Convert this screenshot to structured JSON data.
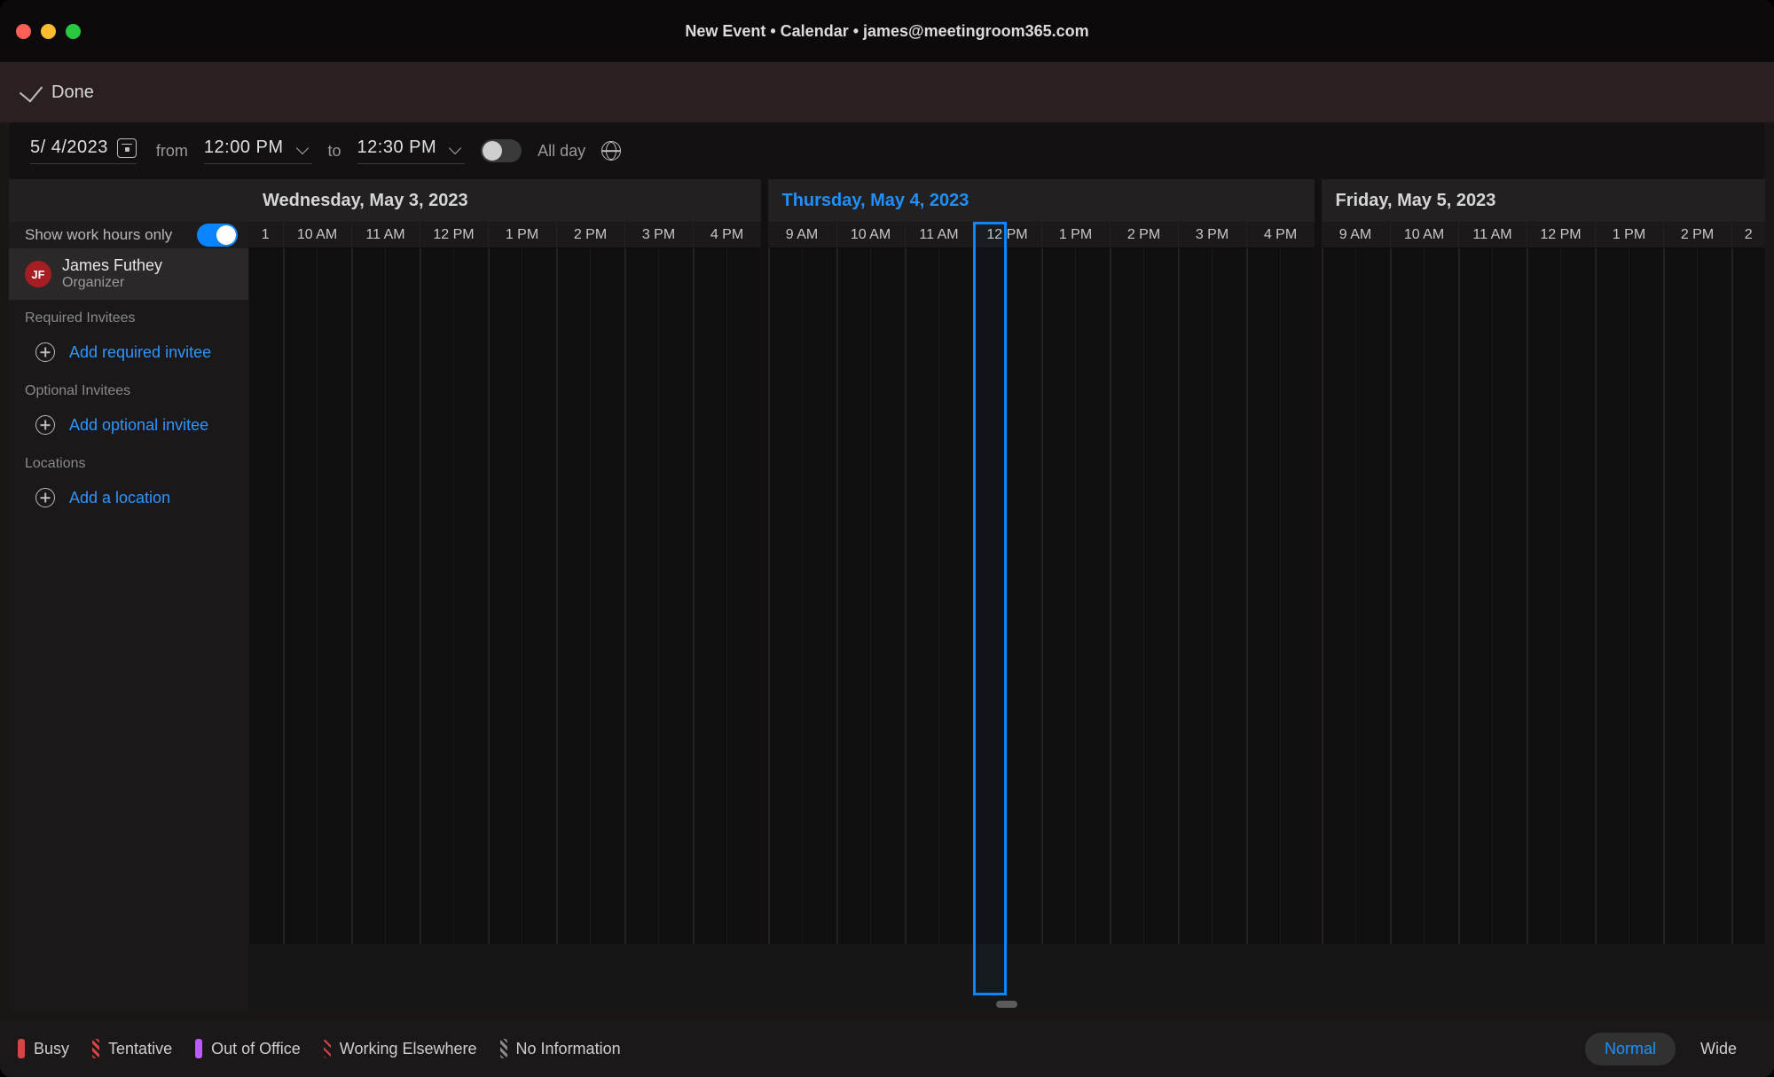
{
  "window": {
    "title": "New Event • Calendar • james@meetingroom365.com"
  },
  "done": {
    "label": "Done"
  },
  "options": {
    "date": "5/ 4/2023",
    "from_label": "from",
    "from_time": "12:00 PM",
    "to_label": "to",
    "to_time": "12:30 PM",
    "allday_label": "All day",
    "allday_on": false
  },
  "sidebar": {
    "work_hours_label": "Show work hours only",
    "work_hours_on": true,
    "organizer": {
      "initials": "JF",
      "name": "James Futhey",
      "role": "Organizer"
    },
    "required_label": "Required Invitees",
    "add_required": "Add required invitee",
    "optional_label": "Optional Invitees",
    "add_optional": "Add optional invitee",
    "locations_label": "Locations",
    "add_location": "Add a location"
  },
  "schedule": {
    "days": [
      {
        "title": "Wednesday, May 3, 2023",
        "current": false,
        "hours": [
          "10 AM",
          "11 AM",
          "12 PM",
          "1 PM",
          "2 PM",
          "3 PM",
          "4 PM"
        ],
        "lead_partial": "1"
      },
      {
        "title": "Thursday, May 4, 2023",
        "current": true,
        "hours": [
          "9 AM",
          "10 AM",
          "11 AM",
          "12 PM",
          "1 PM",
          "2 PM",
          "3 PM",
          "4 PM"
        ]
      },
      {
        "title": "Friday, May 5, 2023",
        "current": false,
        "hours": [
          "9 AM",
          "10 AM",
          "11 AM",
          "12 PM",
          "1 PM",
          "2 PM"
        ],
        "trail_partial": "2"
      }
    ],
    "selection": {
      "day_index": 1,
      "start_hour_idx": 3,
      "span_half_hours": 1
    }
  },
  "legend": {
    "busy": "Busy",
    "tentative": "Tentative",
    "ooo": "Out of Office",
    "we": "Working Elsewhere",
    "noinfo": "No Information"
  },
  "view": {
    "normal": "Normal",
    "wide": "Wide",
    "active": "normal"
  },
  "colors": {
    "accent": "#0a84ff",
    "link": "#2e96ff",
    "busy": "#d64545",
    "ooo": "#b959ff"
  }
}
